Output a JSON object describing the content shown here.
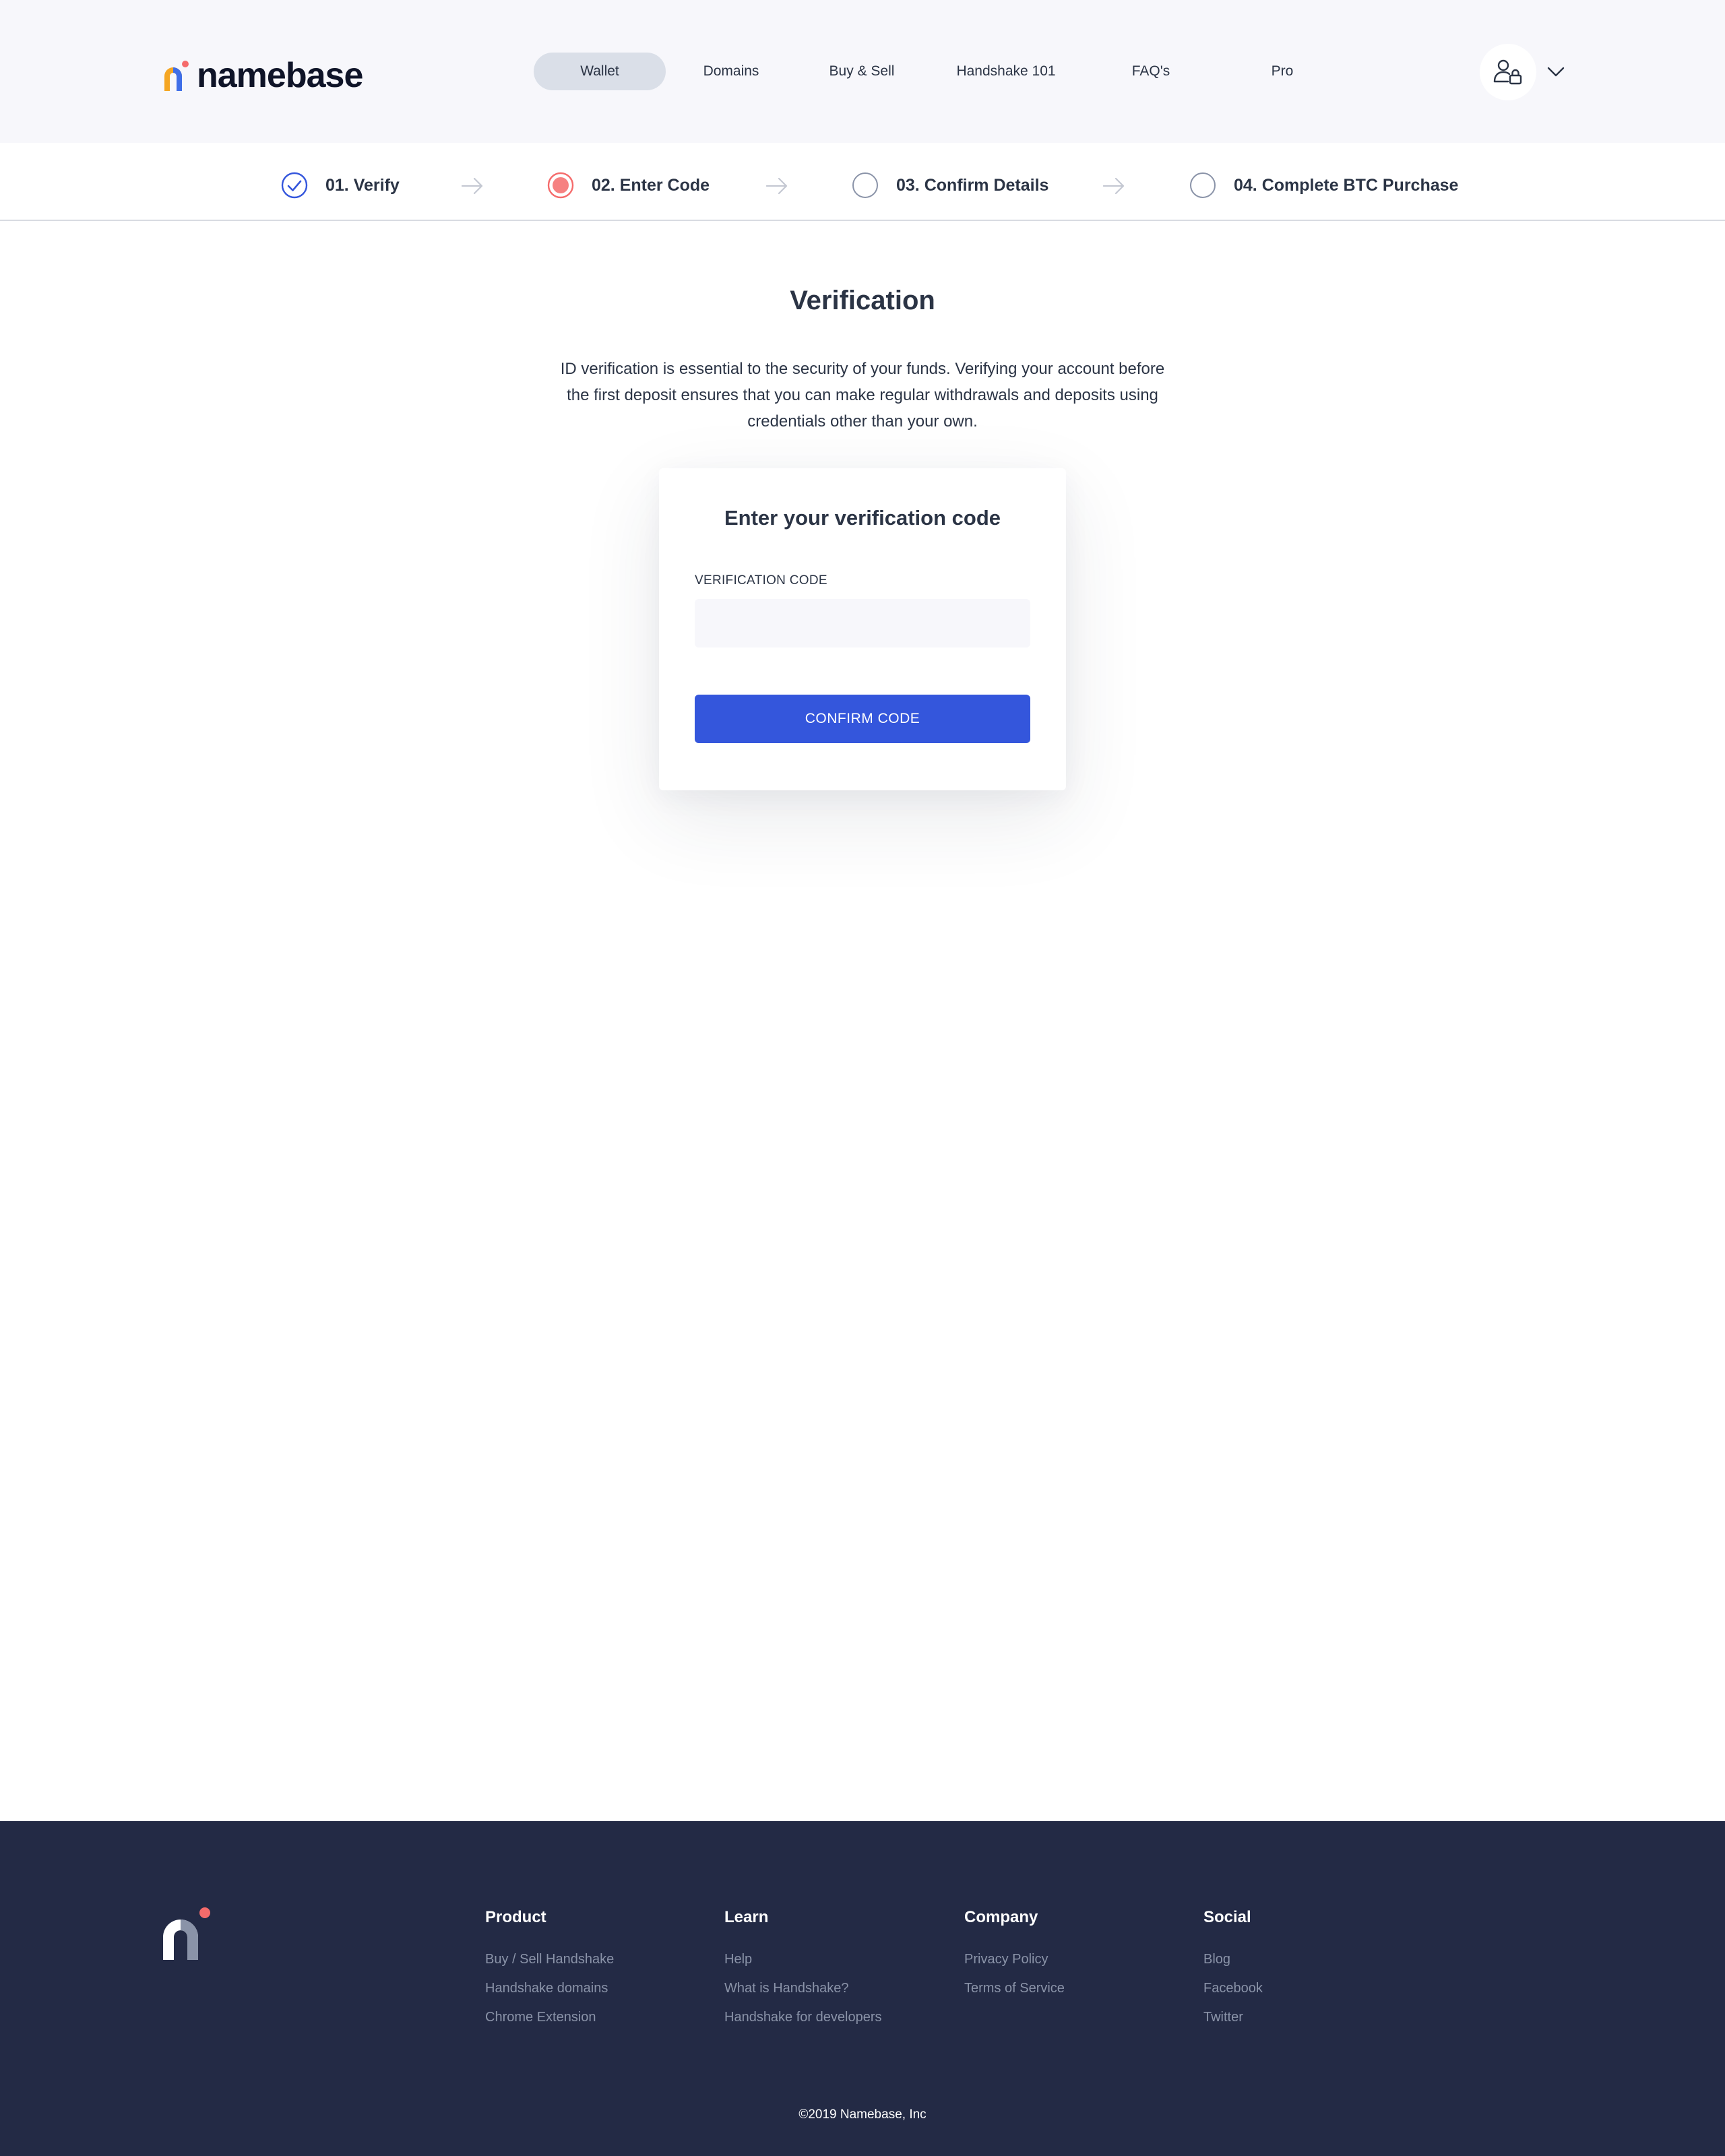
{
  "header": {
    "logo_text": "namebase",
    "nav": [
      {
        "label": "Wallet",
        "active": true
      },
      {
        "label": "Domains",
        "active": false
      },
      {
        "label": "Buy & Sell",
        "active": false
      },
      {
        "label": "Handshake 101",
        "active": false
      },
      {
        "label": "FAQ's",
        "active": false
      },
      {
        "label": "Pro",
        "active": false
      }
    ]
  },
  "stepper": {
    "steps": [
      {
        "label": "01. Verify",
        "state": "complete"
      },
      {
        "label": "02. Enter Code",
        "state": "current"
      },
      {
        "label": "03. Confirm Details",
        "state": "pending"
      },
      {
        "label": "04. Complete BTC Purchase",
        "state": "pending"
      }
    ]
  },
  "main": {
    "title": "Verification",
    "description": "ID verification is essential to the security of your funds. Verifying your account before the first deposit ensures that you can make regular withdrawals and deposits using credentials other than your own.",
    "card": {
      "title": "Enter your verification code",
      "field_label": "VERIFICATION CODE",
      "field_value": "",
      "button_label": "CONFIRM CODE"
    }
  },
  "footer": {
    "columns": [
      {
        "title": "Product",
        "links": [
          "Buy / Sell Handshake",
          "Handshake domains",
          "Chrome Extension"
        ]
      },
      {
        "title": "Learn",
        "links": [
          "Help",
          "What is Handshake?",
          "Handshake for developers"
        ]
      },
      {
        "title": "Company",
        "links": [
          "Privacy Policy",
          "Terms of Service"
        ]
      },
      {
        "title": "Social",
        "links": [
          "Blog",
          "Facebook",
          "Twitter"
        ]
      }
    ],
    "copyright": "©2019 Namebase, Inc"
  },
  "colors": {
    "brand_yellow": "#f5a623",
    "brand_blue": "#3f6ee8",
    "brand_coral": "#f56b6b",
    "primary_button": "#3456dc",
    "step_complete": "#3456dc",
    "step_current": "#f56b6b",
    "footer_bg": "#232a45"
  },
  "icons": {
    "account": "user-lock-icon",
    "dropdown": "chevron-down-icon",
    "step_complete": "check-circle-icon",
    "step_current": "current-step-dot-icon",
    "step_pending": "empty-circle-icon",
    "step_separator": "arrow-right-icon",
    "footer_logo": "namebase-n-logo-icon"
  }
}
